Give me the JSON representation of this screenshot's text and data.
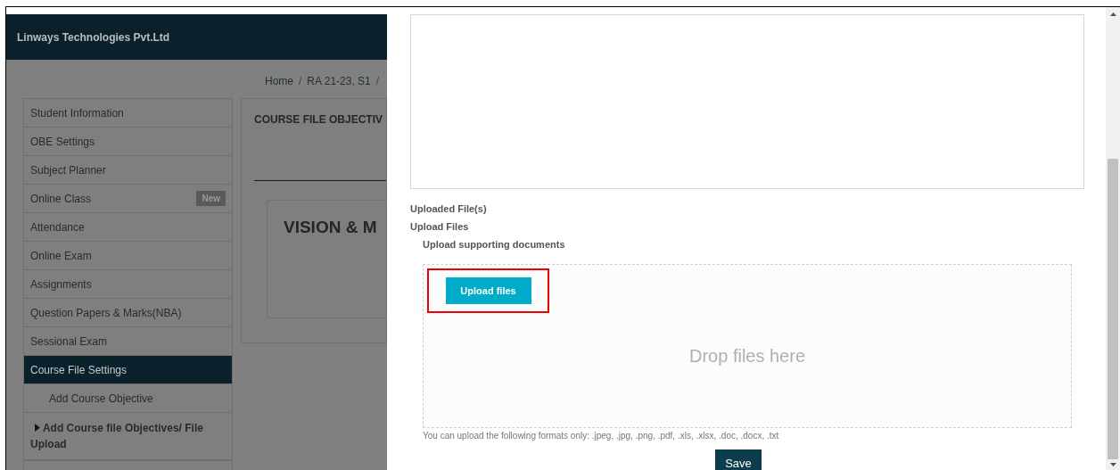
{
  "header": {
    "title": "Linways Technologies Pvt.Ltd"
  },
  "breadcrumb": [
    {
      "label": "Home",
      "separator": "/"
    },
    {
      "label": "RA 21-23, S1",
      "separator": "/"
    }
  ],
  "sidebar": {
    "items": [
      {
        "label": "Student Information",
        "kind": "item",
        "selected": false
      },
      {
        "label": "OBE Settings",
        "kind": "item",
        "selected": false
      },
      {
        "label": "Subject Planner",
        "kind": "item",
        "selected": false
      },
      {
        "label": "Online Class",
        "kind": "item",
        "selected": false,
        "badge": "New"
      },
      {
        "label": "Attendance",
        "kind": "item",
        "selected": false
      },
      {
        "label": "Online Exam",
        "kind": "item",
        "selected": false
      },
      {
        "label": "Assignments",
        "kind": "item",
        "selected": false
      },
      {
        "label": "Question Papers & Marks(NBA)",
        "kind": "item",
        "selected": false
      },
      {
        "label": "Sessional Exam",
        "kind": "item",
        "selected": false
      },
      {
        "label": "Course File Settings",
        "kind": "item",
        "selected": true
      },
      {
        "label": "Add Course Objective",
        "kind": "subitem",
        "selected": false
      },
      {
        "label": "Add Course file Objectives/ File Upload",
        "kind": "expander",
        "selected": false
      }
    ]
  },
  "content": {
    "title": "COURSE FILE OBJECTIV",
    "card_heading": "VISION & M"
  },
  "modal": {
    "labels": [
      "Uploaded File(s)",
      "Upload Files"
    ],
    "upload_heading": "Upload supporting documents",
    "upload_button": "Upload files",
    "highlighted": true,
    "dropzone_text": "Drop files here",
    "formats_hint": "You can upload the following formats only: .jpeg, .jpg, .png, .pdf, .xls, .xlsx, .doc, .docx, .txt",
    "save_button": "Save"
  }
}
